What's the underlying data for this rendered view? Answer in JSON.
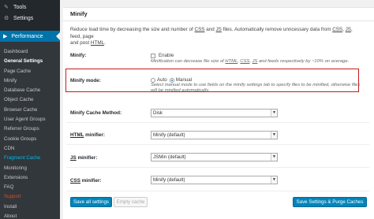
{
  "sidebar": {
    "top_items": [
      {
        "label": "Tools",
        "icon": "wrench-icon"
      },
      {
        "label": "Settings",
        "icon": "settings-icon"
      }
    ],
    "current_menu": {
      "label": "Performance",
      "icon": "performance-icon"
    },
    "submenu": [
      "Dashboard",
      "General Settings",
      "Page Cache",
      "Minify",
      "Database Cache",
      "Object Cache",
      "Browser Cache",
      "User Agent Groups",
      "Referrer Groups",
      "Cookie Groups",
      "CDN",
      "Fragment Cache",
      "Monitoring",
      "Extensions",
      "FAQ",
      "Support",
      "Install",
      "About"
    ]
  },
  "panel": {
    "title": "Minify",
    "intro_prefix": "Reduce load time by decreasing the size and number of ",
    "intro_css": "CSS",
    "intro_and": " and ",
    "intro_js": "JS",
    "intro_mid": " files. Automatically remove unncessary data from ",
    "intro_css2": "CSS",
    "intro_comma": ", ",
    "intro_js2": "JS",
    "intro_feed": ", feed, page",
    "intro_line2": "and post ",
    "intro_html": "HTML",
    "intro_end": ".",
    "minify_label": "Minify:",
    "enable_label": "Enable",
    "minify_desc_prefix": "Minification can decrease file size of ",
    "minify_desc_html": "HTML",
    "minify_desc_sep1": ", ",
    "minify_desc_css": "CSS",
    "minify_desc_sep2": ", ",
    "minify_desc_js": "JS",
    "minify_desc_suffix": " and feeds respectively by ~10% on average.",
    "mode_label": "Minify mode:",
    "mode_auto": "Auto",
    "mode_manual": "Manual",
    "mode_selected": "Manual",
    "mode_desc_line1": "Select manual mode to use fields on the minify settings tab to specify files to be minified, otherwise files",
    "mode_desc_line2": "will be minified automatically.",
    "cache_method_label": "Minify Cache Method:",
    "cache_method_value": "Disk",
    "html_minifier_prefix": "HTML",
    "html_minifier_suffix": " minifier:",
    "html_minifier_value": "Minify (default)",
    "js_minifier_prefix": "JS",
    "js_minifier_suffix": " minifier:",
    "js_minifier_value": "JSMin (default)",
    "css_minifier_prefix": "CSS",
    "css_minifier_suffix": " minifier:",
    "css_minifier_value": "Minify (default)",
    "save_all": "Save all settings",
    "empty_cache": "Empty cache",
    "save_purge": "Save Settings & Purge Caches"
  },
  "colors": {
    "accent": "#0073aa",
    "highlight_border": "#c41c1c",
    "primary_button": "#0085ba"
  }
}
